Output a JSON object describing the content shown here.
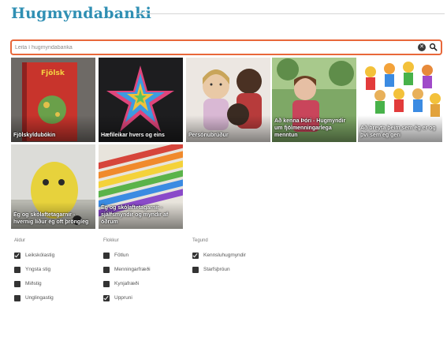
{
  "header": {
    "title": "Hugmyndabanki"
  },
  "search": {
    "placeholder": "Leita í hugmyndabanka",
    "clear_icon": "clear-icon",
    "search_icon": "search-icon"
  },
  "tiles": [
    {
      "caption": "Fjölskyldubókin",
      "icon": "book-image"
    },
    {
      "caption": "Hæfileikar hvers og eins",
      "icon": "star-image"
    },
    {
      "caption": "Persónubrúður",
      "icon": "dolls-image"
    },
    {
      "caption": "Að kenna Þóri - Hugmyndir um fjölmenningarlega menntun",
      "icon": "child-photo"
    },
    {
      "caption": "Að breyta þeim sem ég er og því sem ég geri",
      "icon": "crowd-drawing"
    },
    {
      "caption": "Ég og skólaftetagarnir - hvernig líður ég oft þröngleg",
      "icon": "yellow-figure"
    },
    {
      "caption": "Ég og skólaftetagarnir - sjálfsmyndir og myndir af öðrum",
      "icon": "crayons-image"
    }
  ],
  "filters": [
    {
      "heading": "Aldur",
      "options": [
        {
          "label": "Leikskólastig",
          "checked": true
        },
        {
          "label": "Yngsta stig",
          "checked": false
        },
        {
          "label": "Miðstig",
          "checked": false
        },
        {
          "label": "Unglingastig",
          "checked": false
        }
      ]
    },
    {
      "heading": "Flokkur",
      "options": [
        {
          "label": "Fötlun",
          "checked": false
        },
        {
          "label": "Menningarfræði",
          "checked": false
        },
        {
          "label": "Kynjafræði",
          "checked": false
        },
        {
          "label": "Uppruni",
          "checked": true
        }
      ]
    },
    {
      "heading": "Tegund",
      "options": [
        {
          "label": "Kennsluhugmyndir",
          "checked": true
        },
        {
          "label": "Starfsþróun",
          "checked": false
        }
      ]
    }
  ],
  "colors": {
    "accent": "#2f8fb3",
    "search_border": "#e8673a"
  }
}
